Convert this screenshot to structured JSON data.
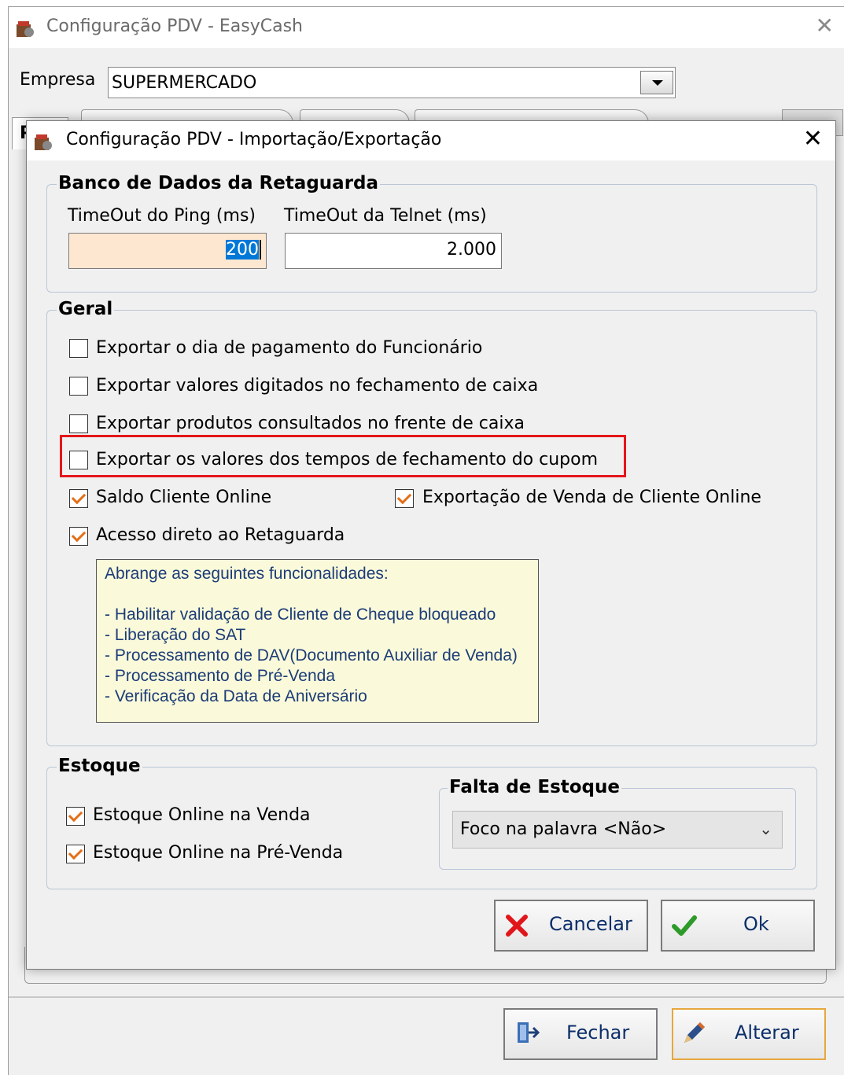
{
  "main_window": {
    "title": "Configuração PDV - EasyCash",
    "close_glyph": "✕",
    "empresa_label": "Empresa",
    "empresa_value": "SUPERMERCADO",
    "tab_letter": "P",
    "buttons": {
      "fechar": "Fechar",
      "alterar": "Alterar"
    }
  },
  "dialog": {
    "title": "Configuração PDV - Importação/Exportação",
    "close_glyph": "✕",
    "banco": {
      "title": "Banco de Dados da Retaguarda",
      "ping_label": "TimeOut do Ping (ms)",
      "ping_value": "200",
      "telnet_label": "TimeOut da Telnet (ms)",
      "telnet_value": "2.000"
    },
    "geral": {
      "title": "Geral",
      "options": [
        {
          "label": "Exportar o dia de pagamento do Funcionário",
          "checked": false
        },
        {
          "label": "Exportar valores digitados no fechamento de caixa",
          "checked": false
        },
        {
          "label": "Exportar produtos consultados no frente de caixa",
          "checked": false
        },
        {
          "label": "Exportar os valores dos tempos de fechamento do cupom",
          "checked": false
        },
        {
          "label": "Saldo Cliente Online",
          "checked": true
        },
        {
          "label": "Exportação de Venda de Cliente Online",
          "checked": true
        },
        {
          "label": "Acesso direto ao Retaguarda",
          "checked": true
        }
      ],
      "info_heading": "Abrange as seguintes funcionalidades:",
      "info_items": [
        "- Habilitar validação de Cliente de Cheque bloqueado",
        "- Liberação do SAT",
        "- Processamento de DAV(Documento Auxiliar de Venda)",
        "- Processamento de Pré-Venda",
        "- Verificação da Data de Aniversário"
      ]
    },
    "estoque": {
      "title": "Estoque",
      "options": [
        {
          "label": "Estoque Online na Venda",
          "checked": true
        },
        {
          "label": "Estoque Online na Pré-Venda",
          "checked": true
        }
      ],
      "falta_title": "Falta de Estoque",
      "falta_value": "Foco na palavra <Não>"
    },
    "buttons": {
      "cancelar": "Cancelar",
      "ok": "Ok"
    }
  },
  "colors": {
    "highlight": "#e4161b",
    "check": "#e36f19",
    "info_text": "#1c3c78",
    "info_bg": "#fafada"
  }
}
